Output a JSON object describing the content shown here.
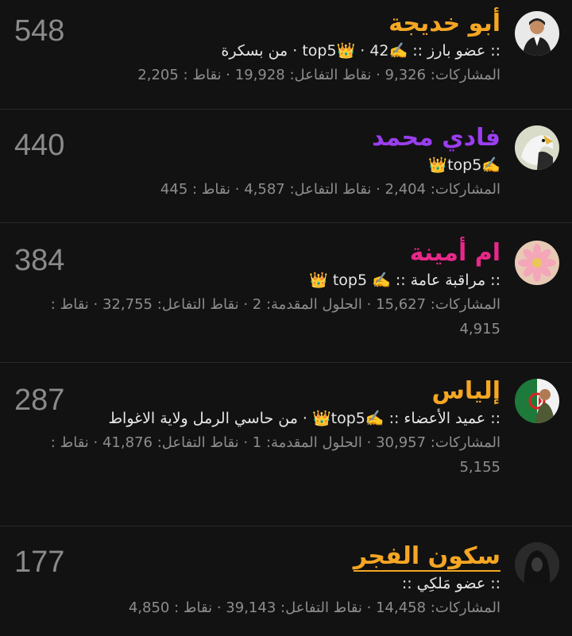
{
  "members": [
    {
      "score": "548",
      "name": "أبو خديجة",
      "name_color": "#f5a623",
      "avatar": "man-in-suit-avatar",
      "info": ":: عضو بارز :: ✍️top5👑 · 42 · من بسكرة",
      "stats": "المشاركات: 9,326 · نقاط التفاعل: 19,928 · نقاط : 2,205"
    },
    {
      "score": "440",
      "name": "فادي محمد",
      "name_color": "#9b3ef0",
      "avatar": "eagle-avatar",
      "info": "✍️top5👑",
      "stats": "المشاركات: 2,404 · نقاط التفاعل: 4,587 · نقاط : 445"
    },
    {
      "score": "384",
      "name": "ام أمينة",
      "name_color": "#e8288a",
      "avatar": "flower-avatar",
      "info": ":: مراقبة عامة :: ✍️ top5 👑",
      "stats": "المشاركات: 15,627 · الحلول المقدمة: 2 · نقاط التفاعل: 32,755 · نقاط : 4,915"
    },
    {
      "score": "287",
      "name": "إلياس",
      "name_color": "#f5a623",
      "avatar": "soldier-flag-avatar",
      "info": ":: عميد الأعضاء :: ✍️top5👑 · من حاسي الرمل ولاية الاغواط",
      "stats": "المشاركات: 30,957 · الحلول المقدمة: 1 · نقاط التفاعل: 41,876 · نقاط : 5,155"
    },
    {
      "score": "177",
      "name": "سكون الفجر",
      "name_color": "#f5a623",
      "avatar": "hooded-figure-avatar",
      "info": ":: عضو مَلكِي ::",
      "stats": "المشاركات: 14,458 · نقاط التفاعل: 39,143 · نقاط : 4,850"
    }
  ]
}
